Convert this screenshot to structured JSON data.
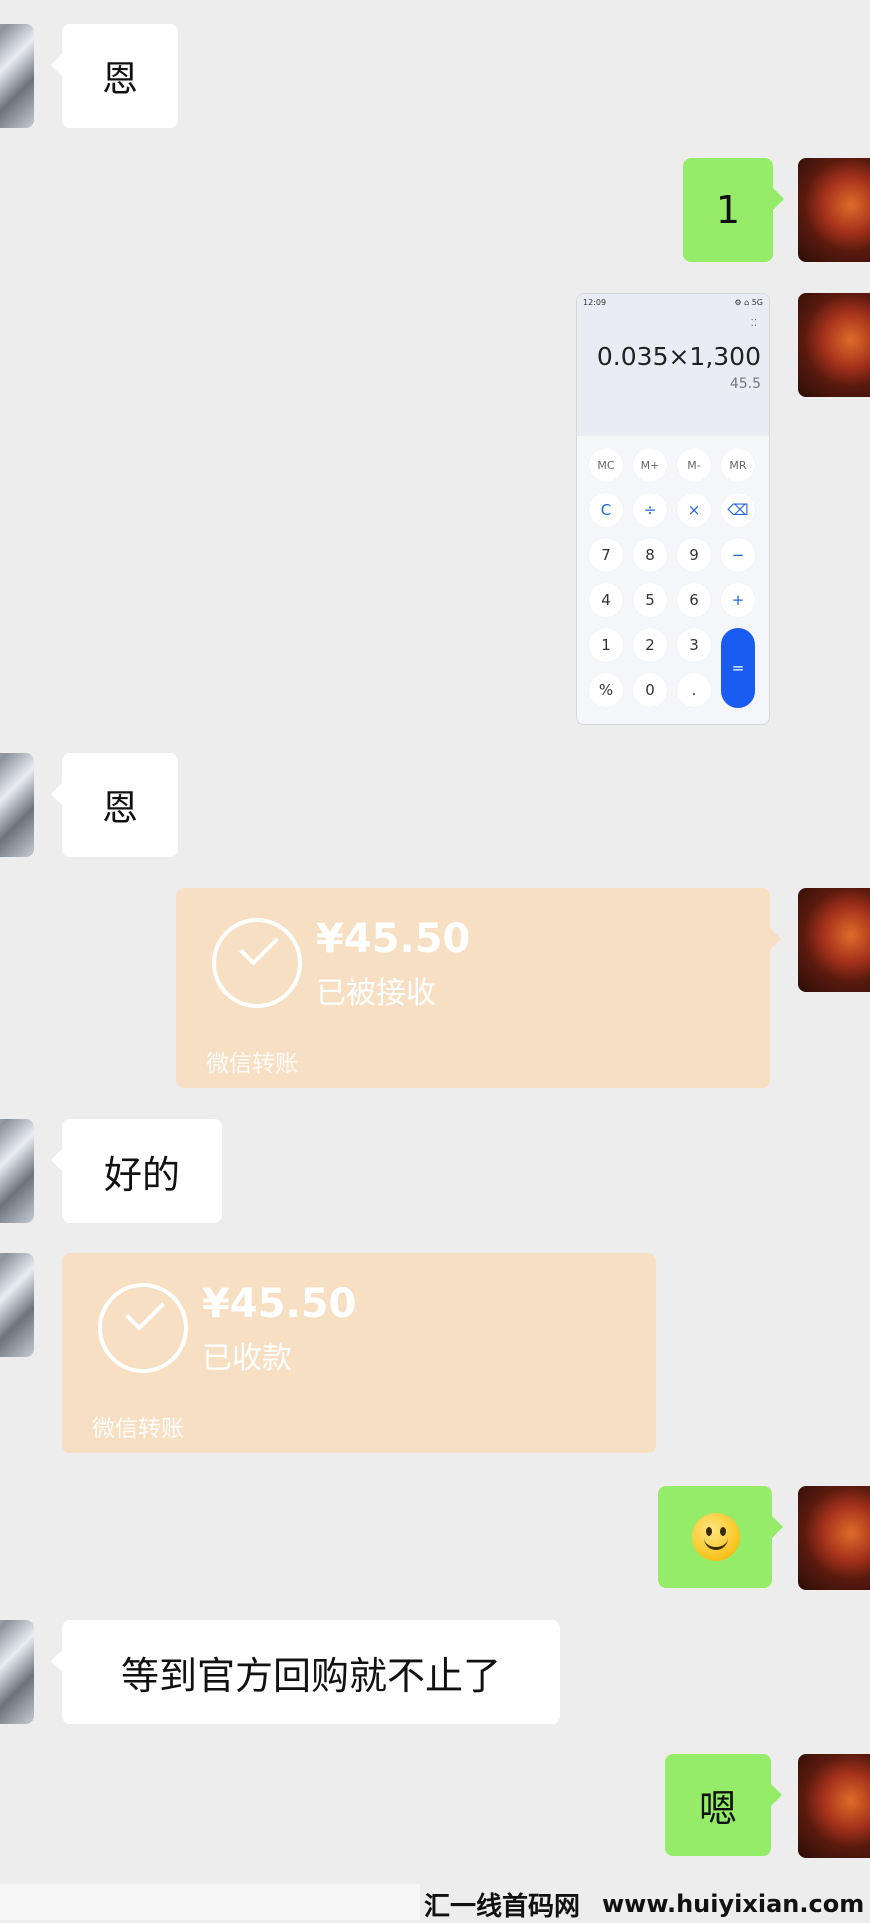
{
  "messages": {
    "m1_text": "恩",
    "m2_text": "1",
    "m3_text": "恩",
    "m5_text": "好的",
    "m8_text": "等到官方回购就不止了",
    "m9_text": "嗯"
  },
  "calculator": {
    "time": "12:09",
    "status_icons": "⚙ ⌂ 5G",
    "expression": "0.035×1,300",
    "result": "45.5",
    "keys": [
      "MC",
      "M+",
      "M-",
      "MR",
      "C",
      "÷",
      "×",
      "⌫",
      "7",
      "8",
      "9",
      "−",
      "4",
      "5",
      "6",
      "+",
      "1",
      "2",
      "3",
      "%",
      "0",
      ".",
      "="
    ]
  },
  "transfer_sent": {
    "amount": "¥45.50",
    "status": "已被接收",
    "label": "微信转账"
  },
  "transfer_received": {
    "amount": "¥45.50",
    "status": "已收款",
    "label": "微信转账"
  },
  "emoji_message": {
    "icon": "smile-emoji"
  },
  "watermark": {
    "brand": "汇一线首码网",
    "url": "www.huiyixian.com"
  },
  "colors": {
    "background": "#ededed",
    "bubble_green": "#95ec69",
    "bubble_white": "#ffffff",
    "transfer_bg": "#f7dfc3",
    "calc_equals": "#1a5cf0"
  }
}
